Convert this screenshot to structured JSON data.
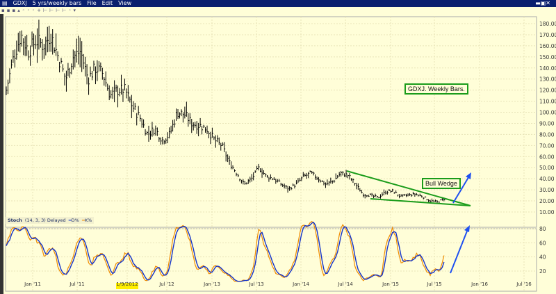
{
  "window": {
    "symbol": "GDXJ",
    "period": "5 yrs/weekly bars",
    "menus": [
      "File",
      "Edit",
      "View"
    ]
  },
  "toolbar": {
    "icons": "▪▪▪▴◦◦◦+⊢⊢⊢⊢◦▾"
  },
  "stoch_legend": {
    "name": "Stoch",
    "params": "(14, 3, 3) Delayed",
    "d_label": "D%",
    "k_label": "K%"
  },
  "annotations": {
    "title": "GDXJ. Weekly Bars.",
    "pattern": "Bull Wedge"
  },
  "colors": {
    "bg": "#fffed8",
    "bars": "#000000",
    "d_line": "#1433c8",
    "k_line": "#f08c00",
    "wedge": "#1a9c1a",
    "arrow": "#1e50f0"
  },
  "chart_data": [
    {
      "type": "bar",
      "title": "GDXJ weekly bars (approx. monthly closes)",
      "x": [
        "Oct '10",
        "Nov '10",
        "Dec '10",
        "Jan '11",
        "Feb '11",
        "Mar '11",
        "Apr '11",
        "May '11",
        "Jun '11",
        "Jul '11",
        "Aug '11",
        "Sep '11",
        "Oct '11",
        "Nov '11",
        "Dec '11",
        "Jan '12",
        "Feb '12",
        "Mar '12",
        "Apr '12",
        "May '12",
        "Jun '12",
        "Jul '12",
        "Aug '12",
        "Sep '12",
        "Oct '12",
        "Nov '12",
        "Dec '12",
        "Jan '13",
        "Feb '13",
        "Mar '13",
        "Apr '13",
        "May '13",
        "Jun '13",
        "Jul '13",
        "Aug '13",
        "Sep '13",
        "Oct '13",
        "Nov '13",
        "Dec '13",
        "Jan '14",
        "Feb '14",
        "Mar '14",
        "Apr '14",
        "May '14",
        "Jun '14",
        "Jul '14",
        "Aug '14",
        "Sep '14",
        "Oct '14",
        "Nov '14",
        "Dec '14",
        "Jan '15",
        "Feb '15",
        "Mar '15",
        "Apr '15",
        "May '15",
        "Jun '15",
        "Jul '15",
        "Aug '15",
        "Sep '15"
      ],
      "values": [
        120,
        150,
        170,
        155,
        165,
        160,
        170,
        150,
        130,
        150,
        155,
        130,
        140,
        135,
        115,
        120,
        120,
        105,
        95,
        80,
        85,
        75,
        80,
        100,
        98,
        90,
        88,
        85,
        75,
        70,
        55,
        45,
        35,
        40,
        50,
        42,
        40,
        35,
        31,
        35,
        42,
        45,
        40,
        35,
        38,
        45,
        43,
        35,
        26,
        25,
        23,
        28,
        29,
        24,
        25,
        26,
        24,
        20,
        19,
        22
      ],
      "ylim": [
        10,
        185
      ],
      "yticks": [
        "180.00",
        "170.00",
        "160.00",
        "150.00",
        "140.00",
        "130.00",
        "120.00",
        "110.00",
        "100.00",
        "90.00",
        "80.00",
        "70.00",
        "60.00",
        "50.00",
        "40.00",
        "30.00",
        "20.00",
        "10.00"
      ],
      "xticks": [
        "Jan '11",
        "Jul '11",
        "1/9/2012",
        "Jul '12",
        "Jan '13",
        "Jul '13",
        "Jan '14",
        "Jul '14",
        "Jan '15",
        "Jul '15",
        "Jan '16",
        "Jul '16"
      ]
    },
    {
      "type": "line",
      "title": "Stoch (14, 3, 3)",
      "series": [
        {
          "name": "D%"
        },
        {
          "name": "K%"
        }
      ],
      "ylim": [
        0,
        100
      ],
      "yticks": [
        "80",
        "60",
        "40",
        "20"
      ]
    }
  ]
}
